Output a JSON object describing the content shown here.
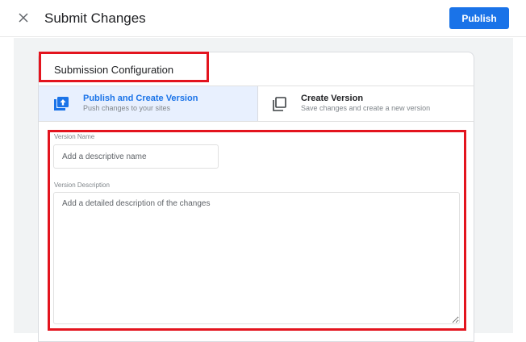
{
  "header": {
    "title": "Submit Changes",
    "publish_label": "Publish"
  },
  "card": {
    "title": "Submission Configuration",
    "options": [
      {
        "title": "Publish and Create Version",
        "subtitle": "Push changes to your sites",
        "selected": true
      },
      {
        "title": "Create Version",
        "subtitle": "Save changes and create a new version",
        "selected": false
      }
    ]
  },
  "form": {
    "version_name": {
      "label": "Version Name",
      "placeholder": "Add a descriptive name",
      "value": ""
    },
    "version_description": {
      "label": "Version Description",
      "placeholder": "Add a detailed description of the changes",
      "value": ""
    }
  },
  "colors": {
    "accent": "#1a73e8",
    "selected_bg": "#e8f0fe",
    "annotation": "#e3141e"
  },
  "icons": {
    "close": "close-icon",
    "publish_version": "publish-upload-icon",
    "create_version": "copy-version-icon"
  }
}
